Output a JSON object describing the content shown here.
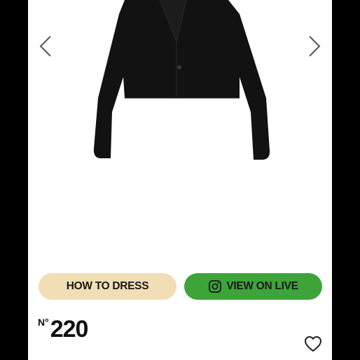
{
  "carousel": {
    "prev_icon": "chevron-left-icon",
    "next_icon": "chevron-right-icon",
    "image_subject": "black cropped blazer"
  },
  "actions": {
    "how_to_dress_label": "HOW TO DRESS",
    "view_on_live_label": "VIEW ON LIVE",
    "view_on_live_icon": "instagram-icon"
  },
  "product": {
    "number_label": "N°",
    "number_value": "220",
    "wishlist_icon": "heart-icon"
  },
  "colors": {
    "how_to_dress_bg": "#f1deb5",
    "view_on_live_bg": "#3ea43a",
    "jacket": "#121212"
  }
}
